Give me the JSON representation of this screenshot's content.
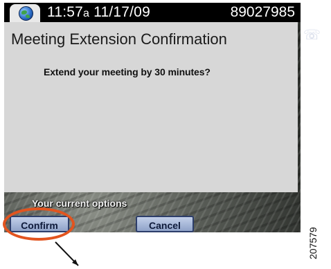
{
  "status_bar": {
    "time": "11:57",
    "time_suffix": "a",
    "date": "11/17/09",
    "extension": "89027985"
  },
  "dialog": {
    "title": "Meeting Extension Confirmation",
    "message": "Extend your meeting by 30 minutes?"
  },
  "options": {
    "label": "Your current options",
    "softkeys": [
      {
        "label": "Confirm"
      },
      {
        "label": "Cancel"
      }
    ]
  },
  "annotation": {
    "figure_number": "207579",
    "highlight_color": "#e2541f"
  },
  "icons": {
    "status": "globe-icon",
    "line": "phone-handset-icon"
  }
}
